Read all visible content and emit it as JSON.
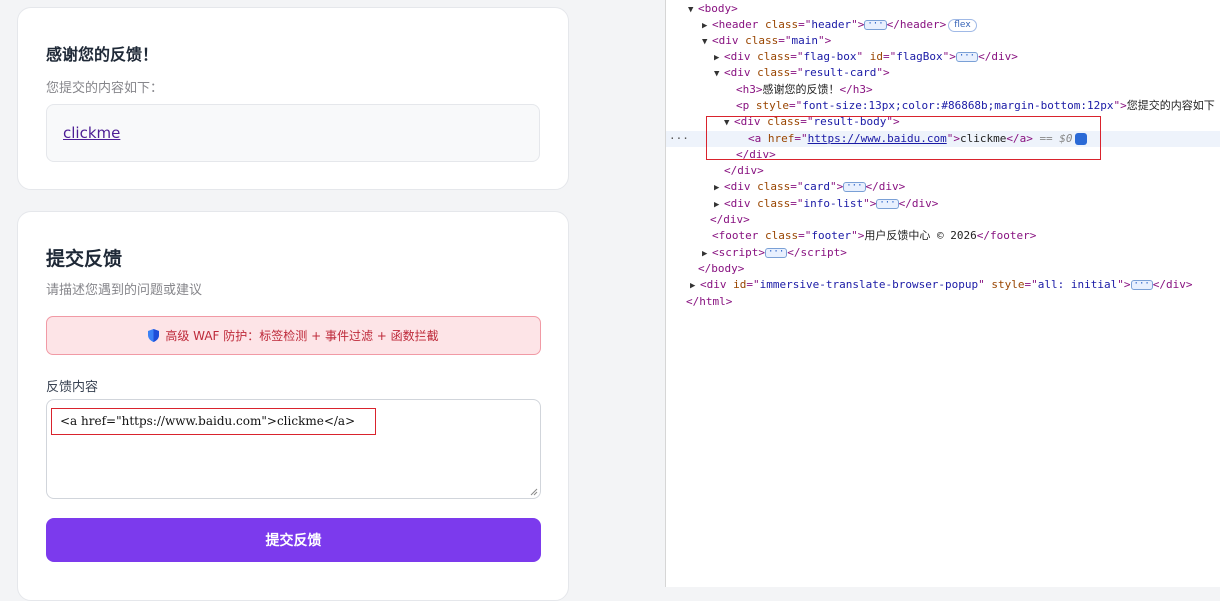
{
  "result_card": {
    "title": "感谢您的反馈！",
    "subtitle": "您提交的内容如下：",
    "link_text": "clickme"
  },
  "form_card": {
    "title": "提交反馈",
    "subtitle": "请描述您遇到的问题或建议",
    "waf_notice": "高级 WAF 防护：标签检测 + 事件过滤 + 函数拦截",
    "field_label": "反馈内容",
    "textarea_value": "<a href=\"https://www.baidu.com\">clickme</a>",
    "submit_label": "提交反馈"
  },
  "devtools": {
    "lines": [
      [
        "body"
      ],
      [
        "header",
        "class",
        "header",
        "flex"
      ],
      [
        "div",
        "class",
        "main"
      ],
      [
        "div",
        "class",
        "flag-box",
        "id",
        "flagBox"
      ],
      [
        "div",
        "class",
        "result-card"
      ],
      [
        "h3",
        "感谢您的反馈！"
      ],
      [
        "p",
        "style",
        "font-size:13px;color:#86868b;margin-bottom:12px",
        "您提交的内容如下"
      ],
      [
        "div",
        "class",
        "result-body"
      ],
      [
        "a",
        "href",
        "https://www.baidu.com",
        "clickme",
        "== $0"
      ],
      [
        "/div"
      ],
      [
        "/div"
      ],
      [
        "div",
        "class",
        "card"
      ],
      [
        "div",
        "class",
        "info-list"
      ],
      [
        "/div"
      ],
      [
        "footer",
        "class",
        "footer",
        "用户反馈中心 © 2026"
      ],
      [
        "script"
      ],
      [
        "/body"
      ],
      [
        "div",
        "id",
        "immersive-translate-browser-popup",
        "style",
        "all: initial"
      ],
      [
        "/html"
      ]
    ]
  },
  "colors": {
    "accent": "#7c3aed",
    "waf_bg": "#fde4e7",
    "waf_text": "#be2a3a",
    "highlight_box": "#d9232d"
  }
}
